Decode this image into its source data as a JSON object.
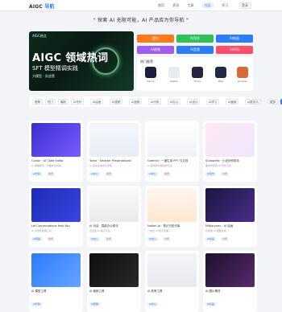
{
  "nav": {
    "logo": "AIGC",
    "logo_accent": "导航",
    "links": [
      "首页",
      "资讯",
      "工具",
      "社区",
      "学习"
    ],
    "active_index": 3,
    "right_label": "登录"
  },
  "hero": {
    "title": "\" 探索 AI 无限可能，AI 产品库为你导航 \""
  },
  "banner": {
    "tag": "AIGC热点",
    "headline": "AIGC 领域热词",
    "subline": "SFT 模型精调实践",
    "small": "大模型 · 实战营"
  },
  "quick_buttons": [
    {
      "label": "提交",
      "color": "#ff7a1a"
    },
    {
      "label": "AI写作",
      "color": "#2fc25b"
    },
    {
      "label": "AI绘画",
      "color": "#2b7cff"
    },
    {
      "label": "AI视频",
      "color": "#a05cf0"
    },
    {
      "label": "AI音频",
      "color": "#2b7cff"
    },
    {
      "label": "AI代码",
      "color": "#ff4d6a"
    }
  ],
  "panel": {
    "title": "热门推荐",
    "apps": [
      {
        "label": "Gen-2",
        "color": "#1b1f3a"
      },
      {
        "label": "Stable",
        "color": "#e7ecf3"
      },
      {
        "label": "Tome",
        "color": "#2a2340"
      },
      {
        "label": "Pika",
        "color": "#1e2a46"
      },
      {
        "label": "Runway",
        "color": "#d66a3a"
      }
    ]
  },
  "filters": [
    "推荐",
    "热门",
    "最新",
    "AI写作",
    "AI绘画",
    "AI视频",
    "AI音频",
    "AI代码",
    "AI办公",
    "AI设计",
    "AI学习",
    "AI营销",
    "AI数字人",
    "更多",
    "全部"
  ],
  "active_filter": 14,
  "cards": [
    {
      "title": "Cursor · AI Code Editor",
      "desc": "AI 编程助手，智能补全代码",
      "badge": "AI代码",
      "badge2": "免费"
    },
    {
      "title": "Tome · Smarter Presentations",
      "desc": "AI 自动生成演示文稿",
      "badge": "AI办公",
      "badge2": "免费"
    },
    {
      "title": "Gamma · 一键生成 PPT 与文档",
      "desc": "AI 驱动的内容创作平台",
      "badge": "AI办公",
      "badge2": "免费"
    },
    {
      "title": "Sudowrite · 小说创作助手",
      "desc": "面向作家的 AI 写作工具",
      "badge": "AI写作",
      "badge2": "付费"
    },
    {
      "title": "Let Conversations Help You",
      "desc": "AI 对话式营销工具",
      "badge": "AI营销",
      "badge2": "免费"
    },
    {
      "title": "AI 对话 · 智能办公助手",
      "desc": "企业级 AI 助手平台",
      "badge": "AI办公",
      "badge2": "免费"
    },
    {
      "title": "Notion AI · 笔记与知识库",
      "desc": "一站式 AI 知识管理",
      "badge": "AI办公",
      "badge2": "付费"
    },
    {
      "title": "Midjourney · AI 绘画",
      "desc": "高质量 AI 图像生成",
      "badge": "AI绘画",
      "badge2": "付费"
    },
    {
      "title": "AI 模型工具",
      "desc": "",
      "badge": "AI代码",
      "badge2": ""
    },
    {
      "title": "AI 营销工具",
      "desc": "",
      "badge": "AI营销",
      "badge2": ""
    },
    {
      "title": "AI 效率工具",
      "desc": "",
      "badge": "AI办公",
      "badge2": ""
    },
    {
      "title": "AI 图片素材",
      "desc": "",
      "badge": "AI绘画",
      "badge2": ""
    }
  ]
}
